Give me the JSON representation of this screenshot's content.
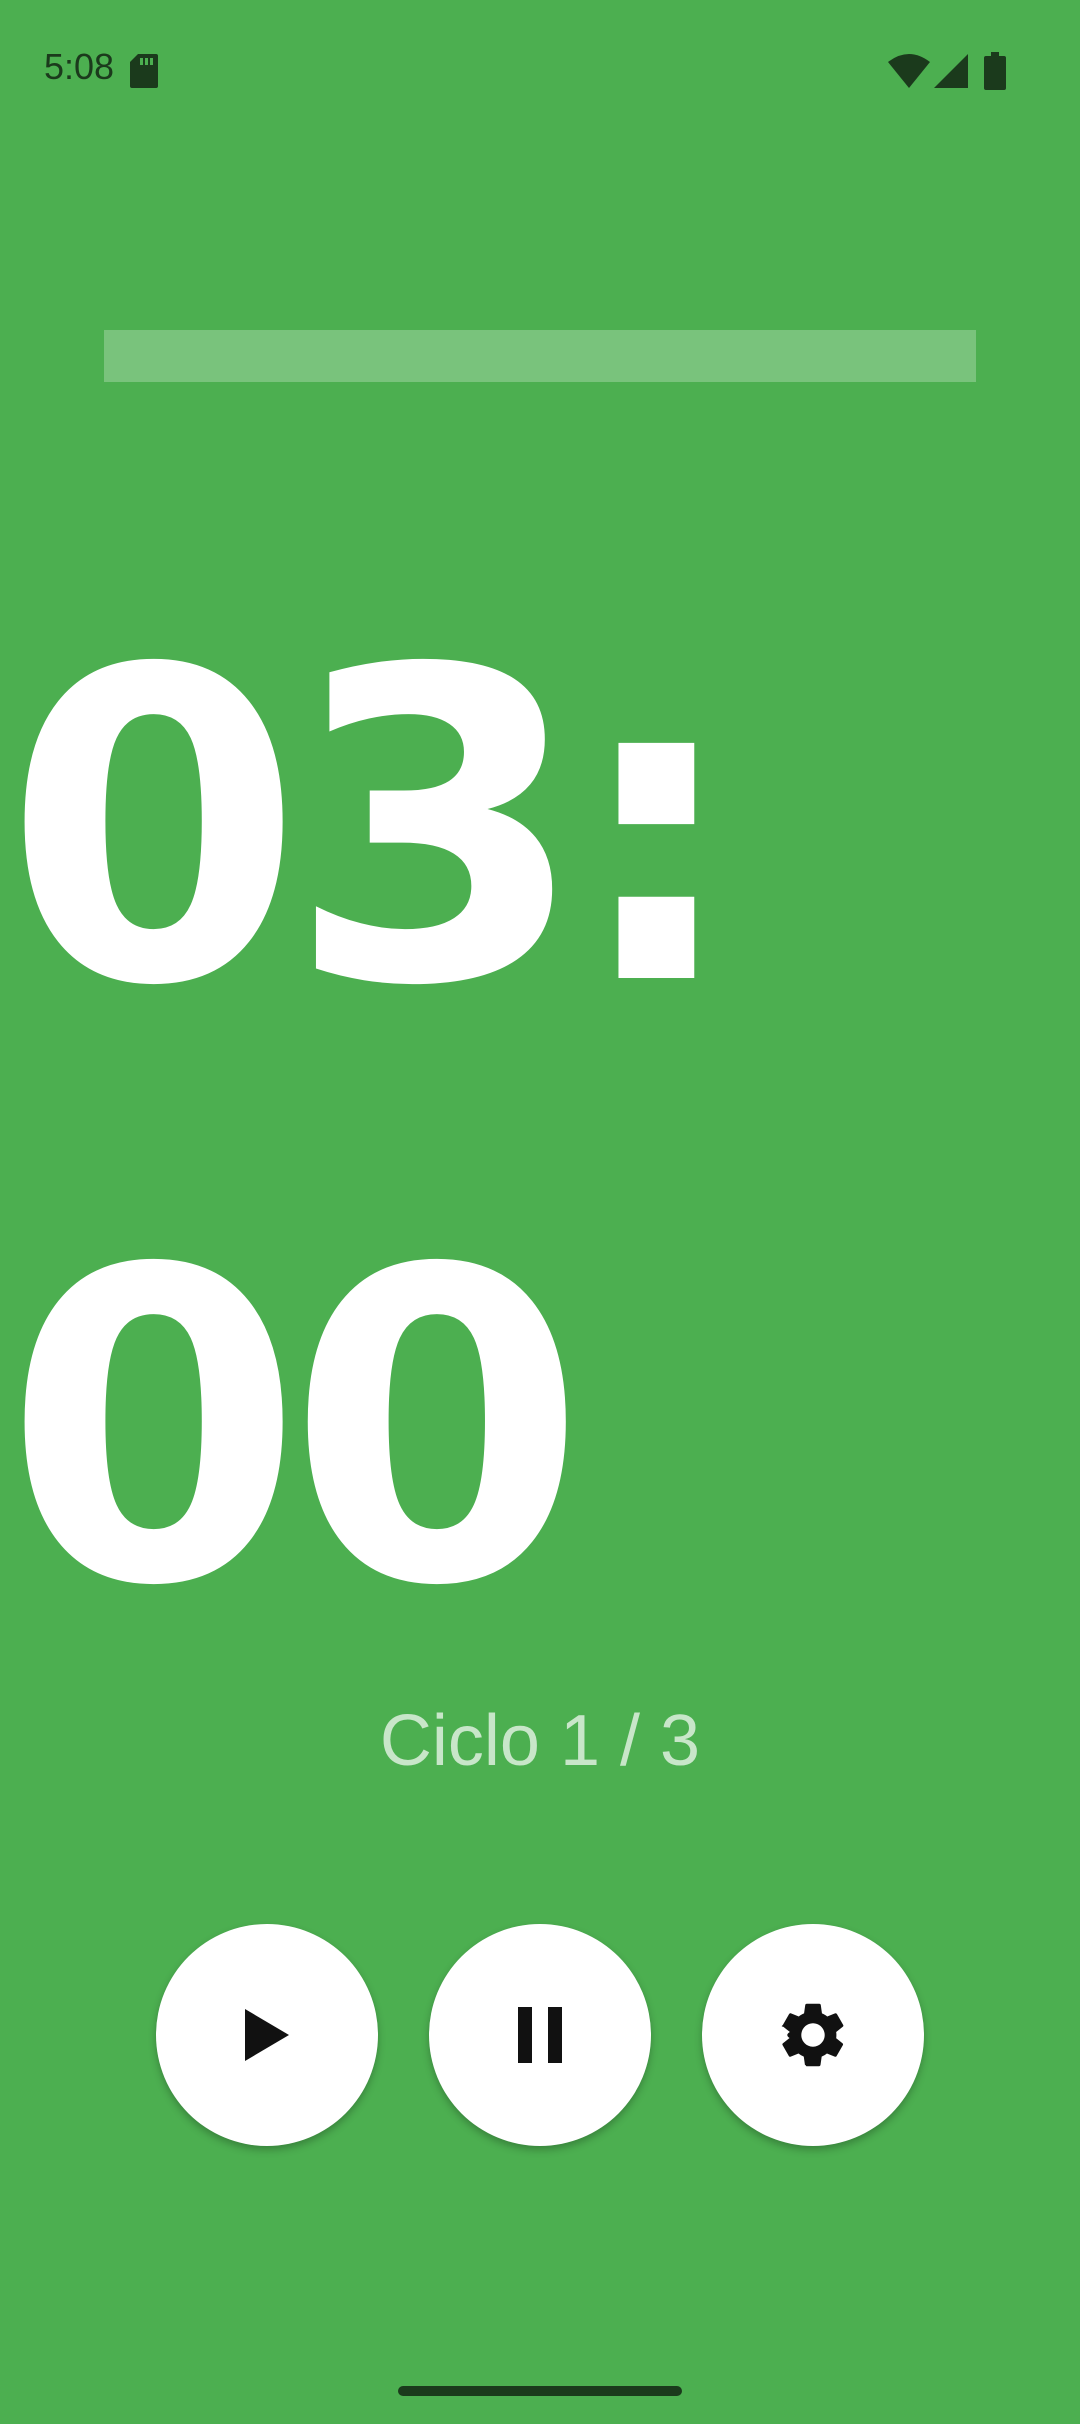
{
  "status_bar": {
    "time": "5:08",
    "icons": [
      "sd-card-icon",
      "wifi-icon",
      "signal-icon",
      "battery-icon"
    ]
  },
  "progress": {
    "fraction": 0.0
  },
  "timer": {
    "display": "03:00"
  },
  "cycle": {
    "label": "Ciclo 1 / 3"
  },
  "controls": {
    "buttons": [
      {
        "name": "play-button",
        "icon": "play-icon"
      },
      {
        "name": "pause-button",
        "icon": "pause-icon"
      },
      {
        "name": "settings-button",
        "icon": "gear-icon"
      }
    ]
  },
  "colors": {
    "background": "#4caf50",
    "timer_text": "#ffffff",
    "cycle_text": "#c8e6c9",
    "button_bg": "#ffffff",
    "icon_color": "#111111"
  }
}
